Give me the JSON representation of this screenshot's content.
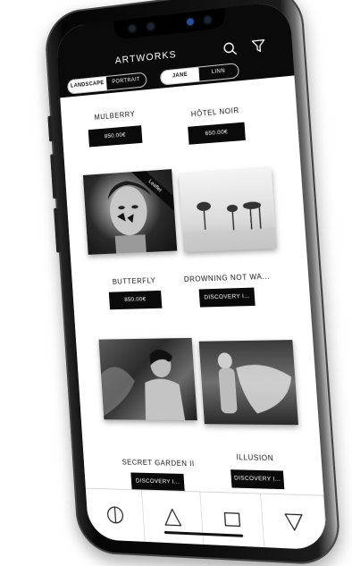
{
  "header": {
    "title": "ARTWORKS"
  },
  "orientation_toggle": {
    "options": [
      "LANDSCAPE",
      "PORTRAIT"
    ],
    "selected": "LANDSCAPE"
  },
  "artist_toggle": {
    "options": [
      "JANE",
      "LINN"
    ],
    "selected": "JANE"
  },
  "artworks": [
    {
      "title": "MULBERRY",
      "price": "850.00€"
    },
    {
      "title": "HÔTEL NOIR",
      "price": "650.00€"
    },
    {
      "title": "BUTTERFLY",
      "price": "850.00€",
      "ribbon": "Leaflet"
    },
    {
      "title": "DROWNING NOT WA...",
      "price": "DISCOVERY I..."
    },
    {
      "title": "SECRET GARDEN II",
      "price": "DISCOVERY I..."
    },
    {
      "title": "ILLUSION",
      "price": "DISCOVERY I..."
    }
  ],
  "tabbar": {
    "icons": [
      "circle-split-icon",
      "triangle-up-icon",
      "square-icon",
      "triangle-down-icon"
    ]
  },
  "colors": {
    "topbar": "#0a0a0a",
    "accent": "#000000",
    "background": "#ffffff"
  }
}
